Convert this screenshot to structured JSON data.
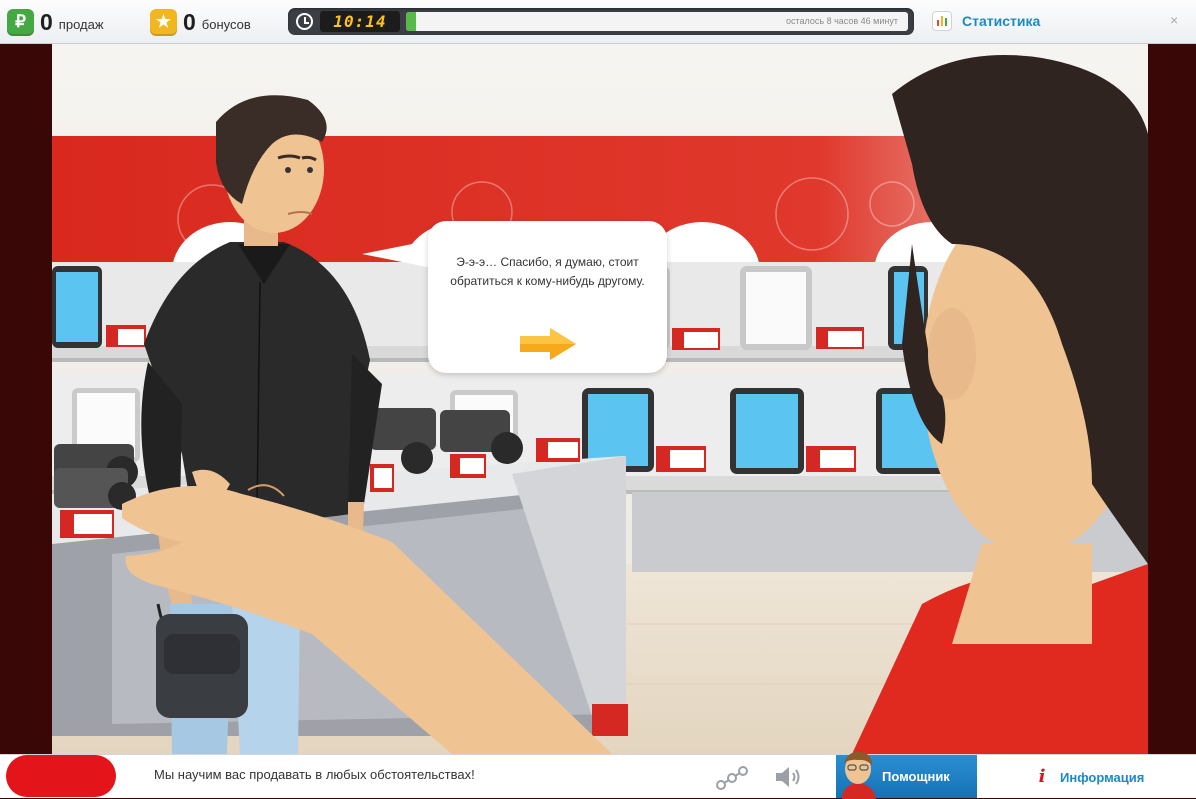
{
  "topbar": {
    "sales": {
      "icon": "ruble-icon",
      "symbol": "₽",
      "count": "0",
      "label": "продаж",
      "color": "#44a843"
    },
    "bonuses": {
      "icon": "star-icon",
      "symbol": "★",
      "count": "0",
      "label": "бонусов",
      "color": "#f3b623"
    },
    "timer": {
      "time": "10:14",
      "remaining_text": "осталось 8 часов 46 минут",
      "progress": 0.02
    },
    "statistics_label": "Статистика",
    "close_symbol": "×"
  },
  "dialogue": {
    "text": "Э-э-э… Спасибо, я думаю, стоит обратиться к кому-нибудь другому.",
    "next_icon": "arrow-right-icon"
  },
  "bottombar": {
    "ticker": "Мы научим вас продавать в любых обстоятельствах!",
    "helper_label": "Помощник",
    "info_symbol": "i",
    "info_label": "Информация"
  },
  "colors": {
    "accent_red": "#e3151a",
    "link_blue": "#1b8ac2",
    "helper_blue": "#1572b5",
    "arrow_orange": "#f7a81b"
  }
}
